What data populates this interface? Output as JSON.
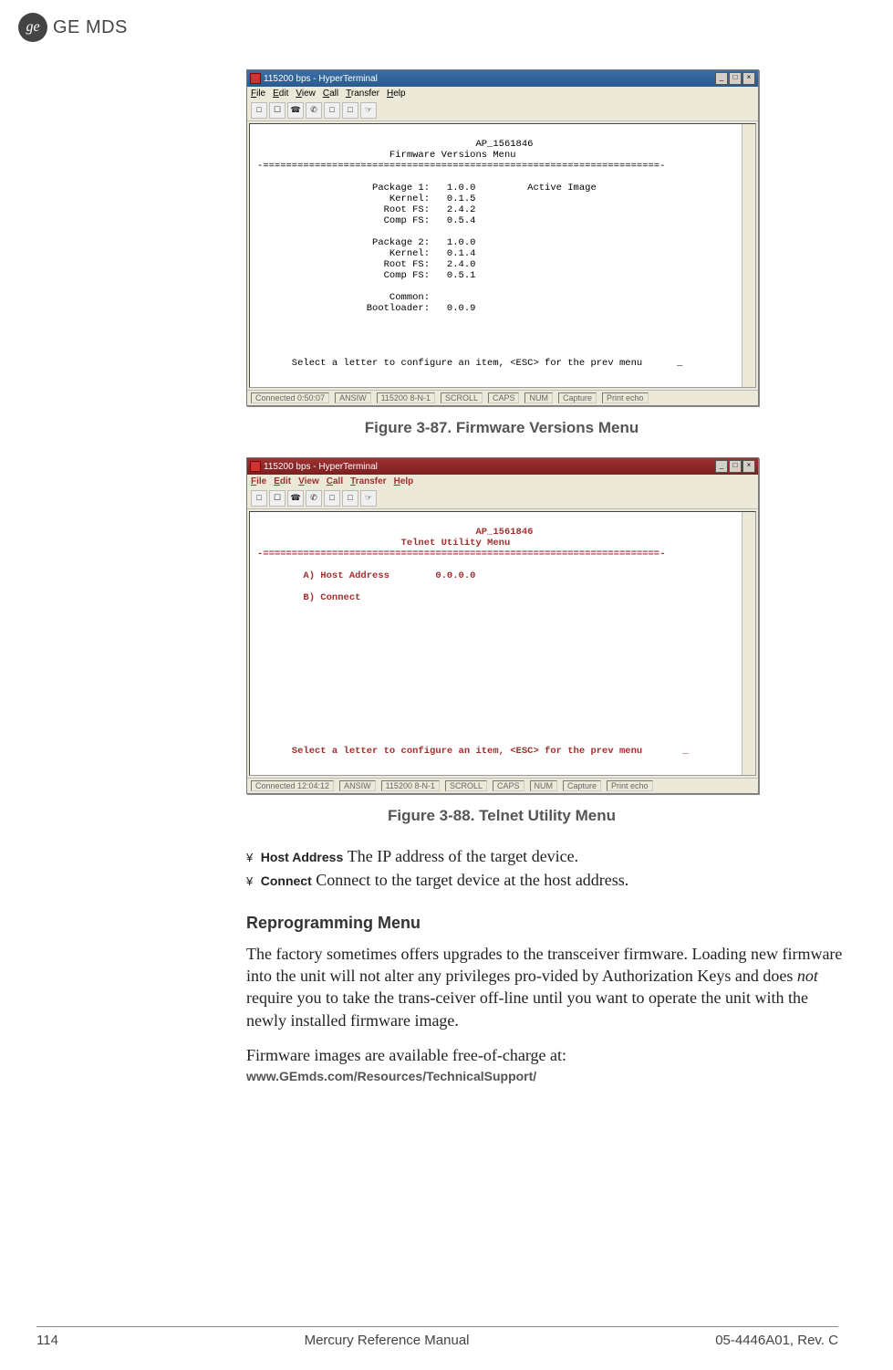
{
  "header": {
    "logo_glyph": "ge",
    "logo_text": "GE MDS"
  },
  "figure1": {
    "window_title": "115200 bps - HyperTerminal",
    "menu": {
      "file": "File",
      "edit": "Edit",
      "view": "View",
      "call": "Call",
      "transfer": "Transfer",
      "help": "Help"
    },
    "terminal_text": "                              AP_1561846\n                       Firmware Versions Menu\n-=====================================================================-\n\n                    Package 1:   1.0.0         Active Image\n                       Kernel:   0.1.5\n                      Root FS:   2.4.2\n                      Comp FS:   0.5.4\n\n                    Package 2:   1.0.0\n                       Kernel:   0.1.4\n                      Root FS:   2.4.0\n                      Comp FS:   0.5.1\n\n                       Common:\n                   Bootloader:   0.0.9\n\n\n\n\n      Select a letter to configure an item, <ESC> for the prev menu      _",
    "status": {
      "connected": "Connected 0:50:07",
      "emul": "ANSIW",
      "baud": "115200 8-N-1",
      "scroll": "SCROLL",
      "caps": "CAPS",
      "num": "NUM",
      "capture": "Capture",
      "printecho": "Print echo"
    },
    "caption": "Figure 3-87. Firmware Versions Menu"
  },
  "figure2": {
    "window_title": "115200 bps - HyperTerminal",
    "menu": {
      "file": "File",
      "edit": "Edit",
      "view": "View",
      "call": "Call",
      "transfer": "Transfer",
      "help": "Help"
    },
    "terminal_text": "                              AP_1561846\n                         Telnet Utility Menu\n-=====================================================================-\n\n        A) Host Address        0.0.0.0\n\n        B) Connect\n\n\n\n\n\n\n\n\n\n\n\n\n\n      Select a letter to configure an item, <ESC> for the prev menu       _",
    "status": {
      "connected": "Connected 12:04:12",
      "emul": "ANSIW",
      "baud": "115200 8-N-1",
      "scroll": "SCROLL",
      "caps": "CAPS",
      "num": "NUM",
      "capture": "Capture",
      "printecho": "Print echo"
    },
    "caption": "Figure 3-88. Telnet Utility Menu"
  },
  "definitions": {
    "bullet": "¥",
    "host_label": "Host Address",
    "host_text": "The IP address of the target device.",
    "connect_label": "Connect",
    "connect_text": "Connect to the target device at the host address."
  },
  "section": {
    "heading": "Reprogramming Menu",
    "para1a": "The factory sometimes offers upgrades to the transceiver firmware. Loading new firmware into the unit will not alter any privileges pro-vided by Authorization Keys and does ",
    "para1_italic": "not",
    "para1b": " require you to take the trans-ceiver off-line until you want to operate the unit with the newly installed firmware image.",
    "para2": "Firmware images are available free-of-charge at:",
    "url": "www.GEmds.com/Resources/TechnicalSupport/"
  },
  "footer": {
    "page": "114",
    "title": "Mercury Reference Manual",
    "doc": "05-4446A01, Rev. C"
  }
}
